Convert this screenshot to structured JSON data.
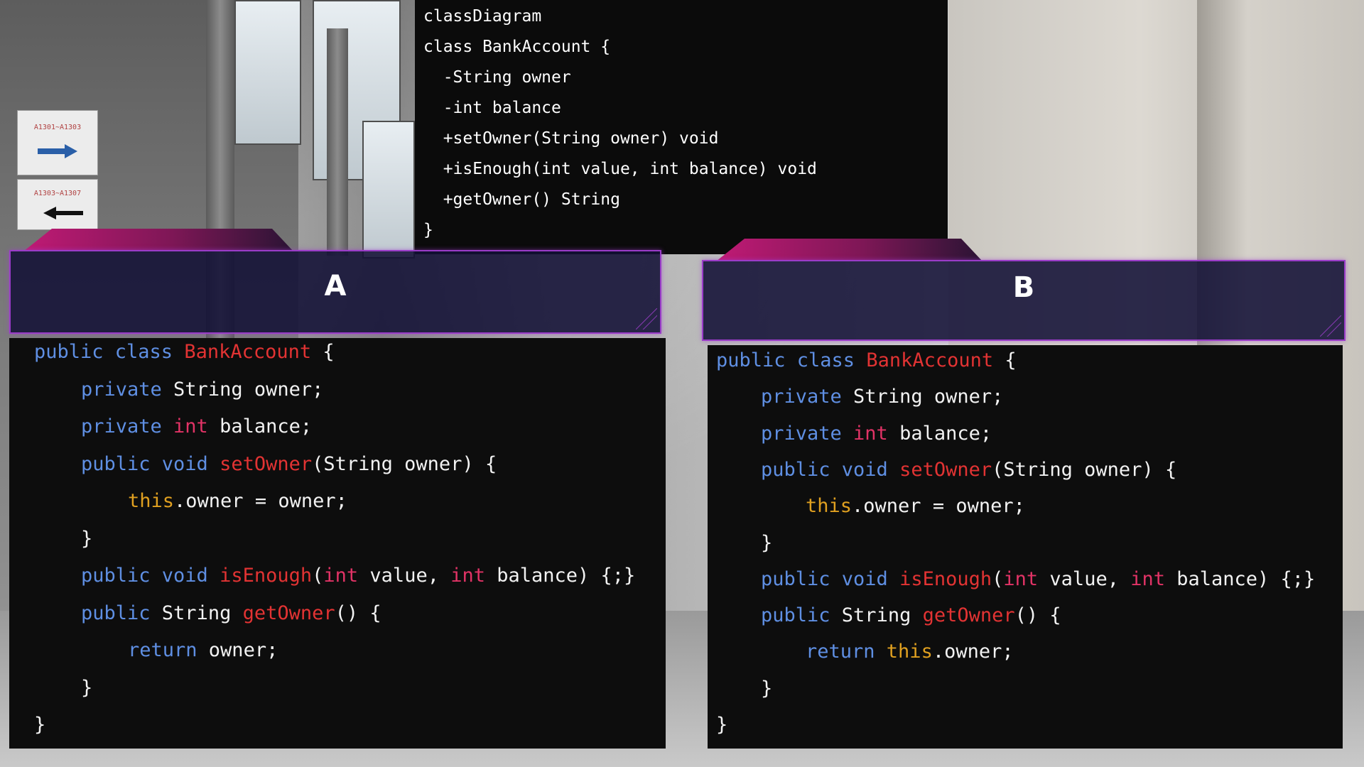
{
  "uml": {
    "lines": [
      "classDiagram",
      "class BankAccount {",
      "  -String owner",
      "  -int balance",
      "  +setOwner(String owner) void",
      "  +isEnough(int value, int balance) void",
      "  +getOwner() String",
      "}"
    ]
  },
  "options": [
    {
      "label": "A",
      "code": [
        {
          "indent": 0,
          "tokens": [
            [
              "kw",
              "public class "
            ],
            [
              "cls",
              "BankAccount"
            ],
            [
              "plain",
              " {"
            ]
          ]
        },
        {
          "indent": 1,
          "tokens": [
            [
              "kw",
              "private "
            ],
            [
              "plain",
              "String owner;"
            ]
          ]
        },
        {
          "indent": 1,
          "tokens": [
            [
              "kw",
              "private "
            ],
            [
              "ty",
              "int "
            ],
            [
              "plain",
              "balance;"
            ]
          ]
        },
        {
          "indent": 1,
          "tokens": [
            [
              "kw",
              "public void "
            ],
            [
              "fn",
              "setOwner"
            ],
            [
              "plain",
              "(String owner) {"
            ]
          ]
        },
        {
          "indent": 2,
          "tokens": [
            [
              "th",
              "this"
            ],
            [
              "plain",
              ".owner = owner;"
            ]
          ]
        },
        {
          "indent": 1,
          "tokens": [
            [
              "plain",
              "}"
            ]
          ]
        },
        {
          "indent": 1,
          "tokens": [
            [
              "kw",
              "public void "
            ],
            [
              "fn",
              "isEnough"
            ],
            [
              "plain",
              "("
            ],
            [
              "ty",
              "int "
            ],
            [
              "plain",
              "value, "
            ],
            [
              "ty",
              "int "
            ],
            [
              "plain",
              "balance) {;}"
            ]
          ]
        },
        {
          "indent": 1,
          "tokens": [
            [
              "kw",
              "public "
            ],
            [
              "plain",
              "String "
            ],
            [
              "fn",
              "getOwner"
            ],
            [
              "plain",
              "() {"
            ]
          ]
        },
        {
          "indent": 2,
          "tokens": [
            [
              "kw",
              "return "
            ],
            [
              "plain",
              "owner;"
            ]
          ]
        },
        {
          "indent": 1,
          "tokens": [
            [
              "plain",
              "}"
            ]
          ]
        },
        {
          "indent": 0,
          "tokens": [
            [
              "plain",
              "}"
            ]
          ]
        }
      ]
    },
    {
      "label": "B",
      "code": [
        {
          "indent": 0,
          "tokens": [
            [
              "kw",
              "public class "
            ],
            [
              "cls",
              "BankAccount"
            ],
            [
              "plain",
              " {"
            ]
          ]
        },
        {
          "indent": 1,
          "tokens": [
            [
              "kw",
              "private "
            ],
            [
              "plain",
              "String owner;"
            ]
          ]
        },
        {
          "indent": 1,
          "tokens": [
            [
              "kw",
              "private "
            ],
            [
              "ty",
              "int "
            ],
            [
              "plain",
              "balance;"
            ]
          ]
        },
        {
          "indent": 1,
          "tokens": [
            [
              "kw",
              "public void "
            ],
            [
              "fn",
              "setOwner"
            ],
            [
              "plain",
              "(String owner) {"
            ]
          ]
        },
        {
          "indent": 2,
          "tokens": [
            [
              "th",
              "this"
            ],
            [
              "plain",
              ".owner = owner;"
            ]
          ]
        },
        {
          "indent": 1,
          "tokens": [
            [
              "plain",
              "}"
            ]
          ]
        },
        {
          "indent": 1,
          "tokens": [
            [
              "kw",
              "public void "
            ],
            [
              "fn",
              "isEnough"
            ],
            [
              "plain",
              "("
            ],
            [
              "ty",
              "int "
            ],
            [
              "plain",
              "value, "
            ],
            [
              "ty",
              "int "
            ],
            [
              "plain",
              "balance) {;}"
            ]
          ]
        },
        {
          "indent": 1,
          "tokens": [
            [
              "kw",
              "public "
            ],
            [
              "plain",
              "String "
            ],
            [
              "fn",
              "getOwner"
            ],
            [
              "plain",
              "() {"
            ]
          ]
        },
        {
          "indent": 2,
          "tokens": [
            [
              "kw",
              "return "
            ],
            [
              "th",
              "this"
            ],
            [
              "plain",
              ".owner;"
            ]
          ]
        },
        {
          "indent": 1,
          "tokens": [
            [
              "plain",
              "}"
            ]
          ]
        },
        {
          "indent": 0,
          "tokens": [
            [
              "plain",
              "}"
            ]
          ]
        }
      ]
    }
  ],
  "background_signs": [
    "A1301~A1303",
    "A1303~A1307"
  ],
  "colors": {
    "keyword": "#5f8fe3",
    "class_name": "#e23333",
    "function": "#e23333",
    "type": "#e23366",
    "this": "#e0a020",
    "text": "#f2f2f2",
    "header_border": "#9a3cc8",
    "header_fill": "#121036",
    "tab_magenta": "#c01a75"
  }
}
